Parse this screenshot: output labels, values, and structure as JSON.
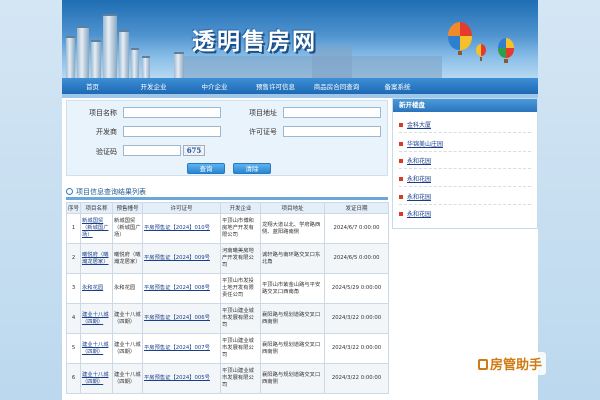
{
  "site": {
    "title": "透明售房网"
  },
  "nav": [
    "首页",
    "开发企业",
    "中介企业",
    "预售许可信息",
    "商品房合同查询",
    "备案系统"
  ],
  "search": {
    "project_name_label": "项目名称",
    "project_address_label": "项目地址",
    "developer_label": "开发商",
    "license_label": "许可证号",
    "captcha_label": "验证码",
    "captcha_text": "675",
    "query_label": "查询",
    "clear_label": "清除"
  },
  "results": {
    "title": "项目信息查询结果列表",
    "headers": [
      "序号",
      "项目名称",
      "预售幢号",
      "许可证号",
      "开发企业",
      "项目地址",
      "发证日期"
    ],
    "rows": [
      [
        "1",
        "新城国贸（新城国广场）",
        "新城国贸（新城国广场）",
        "平房预售证【2024】010号",
        "平顶山市博和房地产开发有限公司",
        "龙翔大道以北、学府路西侧、蓝阳路南侧",
        "2024/6/7 0:00:00"
      ],
      [
        "2",
        "曦悦府（曦瀚龙居家）",
        "曦悦府（曦瀚龙居家）",
        "平房预售证【2024】009号",
        "河南曦美房地产开发有限公司",
        "诚轩路与南环路交叉口东北角",
        "2024/6/5 0:00:00"
      ],
      [
        "3",
        "永和花园",
        "永和花园",
        "平房预售证【2024】008号",
        "平顶山市发投土地开发有限责任公司",
        "平顶山市紫金山路与平安路交叉口西南角",
        "2024/5/29 0:00:00"
      ],
      [
        "4",
        "建业十八城（四期）",
        "建业十八城（四期）",
        "平房预售证【2024】006号",
        "平顶山建业城市发展有限公司",
        "襄阳路与规划道路交叉口西南侧",
        "2024/3/22 0:00:00"
      ],
      [
        "5",
        "建业十八城（四期）",
        "建业十八城（四期）",
        "平房预售证【2024】007号",
        "平顶山建业城市发展有限公司",
        "襄阳路与规划道路交叉口西南侧",
        "2024/3/22 0:00:00"
      ],
      [
        "6",
        "建业十八城（四期）",
        "建业十八城（四期）",
        "平房预售证【2024】005号",
        "平顶山建业城市发展有限公司",
        "襄阳路与规划道路交叉口西南侧",
        "2024/3/22 0:00:00"
      ]
    ]
  },
  "sidebar": {
    "title": "新开楼盘",
    "items": [
      "金科大厦",
      "华锦美山庄园",
      "永和花园",
      "永和花园",
      "永和花园",
      "永和花园"
    ]
  },
  "watermark": {
    "text": "房管助手"
  },
  "colors": {
    "nav": "#1d69b3",
    "link": "#1a3f8a",
    "accent": "#d07a12"
  }
}
